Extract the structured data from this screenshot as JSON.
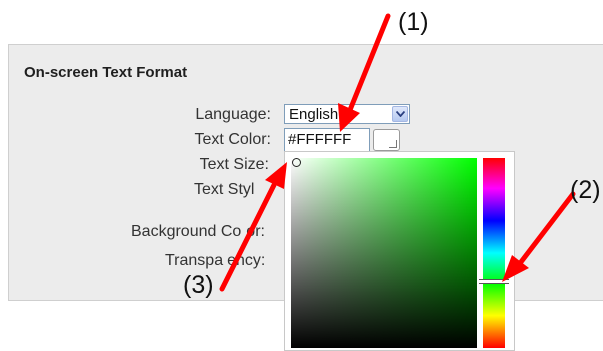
{
  "panel": {
    "title": "On-screen Text Format",
    "labels": {
      "language": "Language:",
      "text_color": "Text Color:",
      "text_size": "Text Size:",
      "text_style": "Text Styl",
      "background_color": "Background Co",
      "background_color_tail": "or:",
      "transparency": "Transpa",
      "transparency_tail": "ency:"
    },
    "language_select": {
      "value": "English"
    },
    "text_color_input": {
      "value": "#FFFFFF"
    }
  },
  "color_picker": {
    "selected_hue": "#00ff00",
    "hue_level": 0.66
  },
  "annotations": {
    "callout_1": "(1)",
    "callout_2": "(2)",
    "callout_3": "(3)",
    "arrow_color": "#ff0000"
  }
}
